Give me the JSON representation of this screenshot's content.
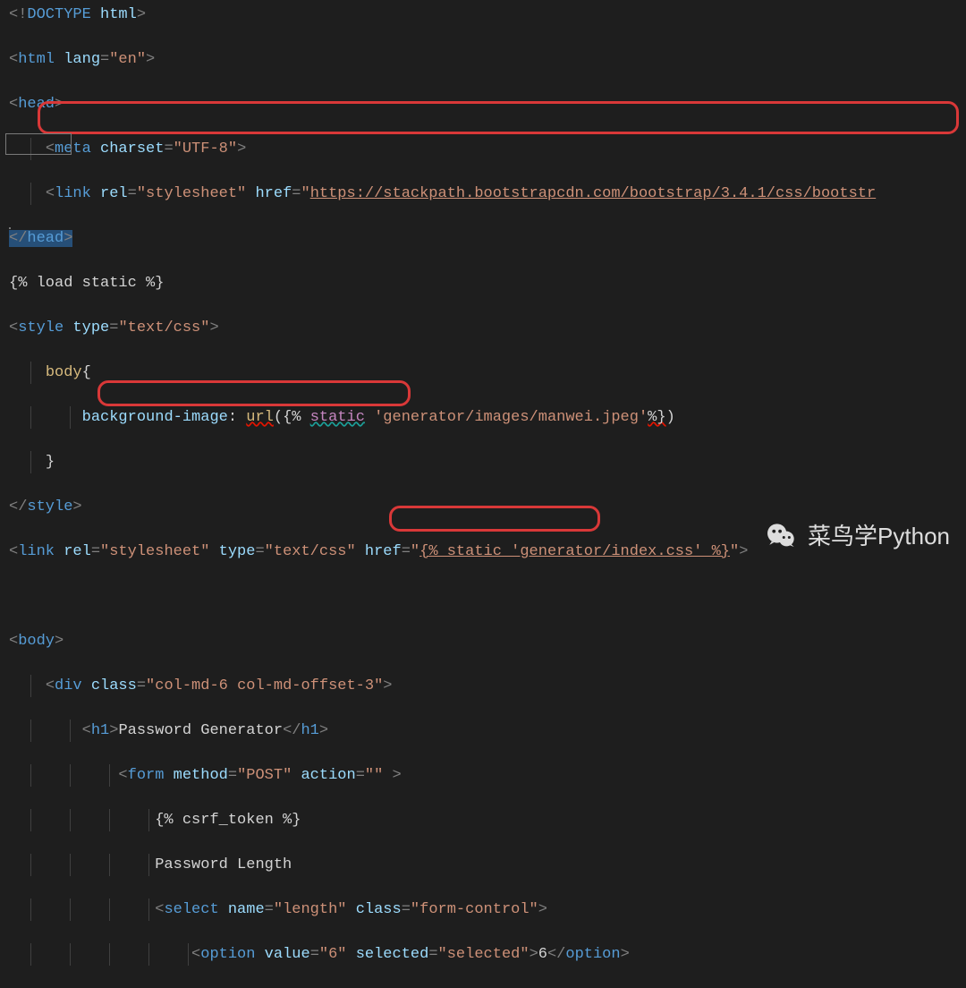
{
  "code": {
    "l1a": "<!",
    "l1b": "DOCTYPE",
    "l1c": " html",
    "l1d": ">",
    "l2a": "<",
    "l2b": "html",
    "l2c": " lang",
    "l2d": "=",
    "l2e": "\"en\"",
    "l2f": ">",
    "l3a": "<",
    "l3b": "head",
    "l3c": ">",
    "l4a": "<",
    "l4b": "meta",
    "l4c": " charset",
    "l4d": "=",
    "l4e": "\"UTF-8\"",
    "l4f": ">",
    "l5a": "<",
    "l5b": "link",
    "l5c": " rel",
    "l5d": "=",
    "l5e": "\"stylesheet\"",
    "l5f": " href",
    "l5g": "=",
    "l5h": "\"",
    "l5i": "https://stackpath.bootstrapcdn.com/bootstrap/3.4.1/css/bootstr",
    "l5j": "",
    "l6a": "</",
    "l6b": "head",
    "l6c": ">",
    "l7a": "{% load static %}",
    "l8a": "<",
    "l8b": "style",
    "l8c": " type",
    "l8d": "=",
    "l8e": "\"text/css\"",
    "l8f": ">",
    "l9a": "body",
    "l9b": "{",
    "l10a": "background-image",
    "l10b": ": ",
    "l10c": "url",
    "l10d": "(",
    "l10e": "{% ",
    "l10f": "static",
    "l10g": " 'generator/images/manwei.jpeg'",
    "l10h": "%}",
    "l10i": ")",
    "l11a": "}",
    "l12a": "</",
    "l12b": "style",
    "l12c": ">",
    "l13a": "<",
    "l13b": "link",
    "l13c": " rel",
    "l13d": "=",
    "l13e": "\"stylesheet\"",
    "l13f": " type",
    "l13g": "=",
    "l13h": "\"text/css\"",
    "l13i": " href",
    "l13j": "=",
    "l13k": "\"",
    "l13l": "{% static 'generator/index.css' %}",
    "l13m": "\"",
    "l13n": ">",
    "l15a": "<",
    "l15b": "body",
    "l15c": ">",
    "l16a": "<",
    "l16b": "div",
    "l16c": " class",
    "l16d": "=",
    "l16e": "\"col-md-6 col-md-offset-3\"",
    "l16f": ">",
    "l17a": "<",
    "l17b": "h1",
    "l17c": ">",
    "l17d": "Password Generator",
    "l17e": "</",
    "l17f": "h1",
    "l17g": ">",
    "l18a": "<",
    "l18b": "form",
    "l18c": " method",
    "l18d": "=",
    "l18e": "\"POST\"",
    "l18f": " action",
    "l18g": "=",
    "l18h": "\"\"",
    "l18i": " >",
    "l19a": "{% csrf_token %}",
    "l20a": "Password Length",
    "l21a": "<",
    "l21b": "select",
    "l21c": " name",
    "l21d": "=",
    "l21e": "\"length\"",
    "l21f": " class",
    "l21g": "=",
    "l21h": "\"form-control\"",
    "l21i": ">",
    "l22a": "<",
    "l22b": "option",
    "l22c": " value",
    "l22d": "=",
    "l22e": "\"6\"",
    "l22f": " selected",
    "l22g": "=",
    "l22h": "\"selected\"",
    "l22i": ">",
    "l22j": "6",
    "l22k": "</",
    "l22l": "option",
    "l22m": ">"
  },
  "wm": "菜鸟学Python"
}
